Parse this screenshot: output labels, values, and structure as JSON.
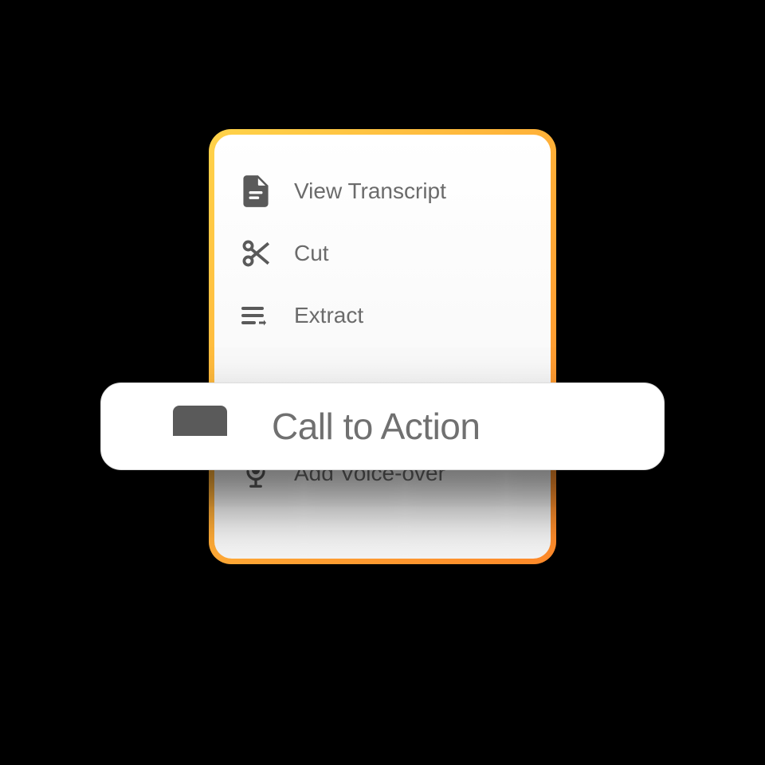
{
  "menu": {
    "items": [
      {
        "label": "View Transcript"
      },
      {
        "label": "Cut"
      },
      {
        "label": "Extract"
      },
      {
        "label": "Add Voice-over"
      }
    ]
  },
  "cta": {
    "label": "Call to Action"
  }
}
